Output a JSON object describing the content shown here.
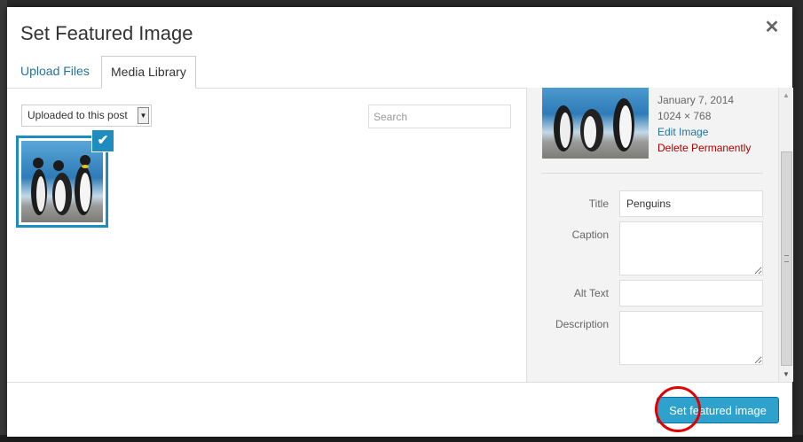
{
  "modal": {
    "title": "Set Featured Image",
    "close_icon": "close-icon"
  },
  "tabs": [
    {
      "label": "Upload Files",
      "active": false
    },
    {
      "label": "Media Library",
      "active": true
    }
  ],
  "browser": {
    "filter_selected": "Uploaded to this post",
    "search_placeholder": "Search",
    "attachments": [
      {
        "image": "penguins",
        "selected": true
      }
    ]
  },
  "details": {
    "date": "January 7, 2014",
    "dimensions": "1024 × 768",
    "edit_label": "Edit Image",
    "delete_label": "Delete Permanently",
    "fields": {
      "title_label": "Title",
      "title_value": "Penguins",
      "caption_label": "Caption",
      "caption_value": "",
      "alt_label": "Alt Text",
      "alt_value": "",
      "description_label": "Description",
      "description_value": ""
    }
  },
  "toolbar": {
    "primary_label": "Set featured image"
  },
  "colors": {
    "accent": "#2ea2cc",
    "link": "#21759b",
    "delete": "#aa0000",
    "annotation": "#e00000"
  }
}
